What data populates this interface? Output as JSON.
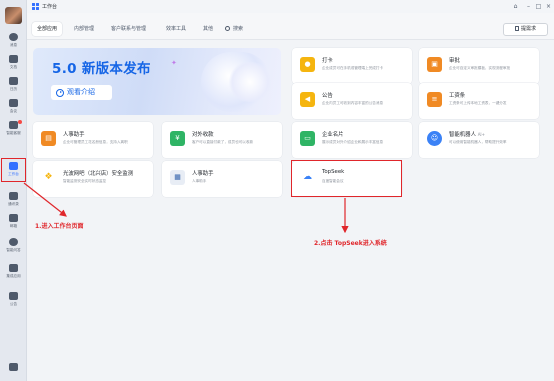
{
  "app": {
    "title": "工作台"
  },
  "window_buttons": [
    "⌂",
    "–",
    "□",
    "×"
  ],
  "rail": {
    "items": [
      {
        "label": "消息"
      },
      {
        "label": "文档"
      },
      {
        "label": "日历"
      },
      {
        "label": "会议"
      },
      {
        "label": "智能客服"
      },
      {
        "label": "工作台"
      },
      {
        "label": "通讯录"
      },
      {
        "label": "邮箱"
      },
      {
        "label": "智能问答"
      },
      {
        "label": "集成应用"
      },
      {
        "label": "公告"
      }
    ]
  },
  "toolbar": {
    "tabs": [
      {
        "label": "全部应用",
        "active": true
      },
      {
        "label": "内部管理",
        "active": false
      },
      {
        "label": "客户联系与管理",
        "active": false
      },
      {
        "label": "效率工具",
        "active": false
      },
      {
        "label": "其他",
        "active": false
      }
    ],
    "search_label": "搜索",
    "apply_label": "提需求"
  },
  "banner": {
    "headline": "5.0 新版本发布",
    "button_label": "观看介绍"
  },
  "cards": [
    {
      "title": "打卡",
      "desc": "企业成员可在手机或管理端上完成打卡",
      "icon": "location-icon",
      "color": "#f5b50f"
    },
    {
      "title": "审批",
      "desc": "企业可自定义审批模板，实现流程审批",
      "icon": "approval-icon",
      "color": "#f08a24"
    },
    {
      "title": "公告",
      "desc": "企业内员工可收到内容丰富的公告消息",
      "icon": "megaphone-icon",
      "color": "#f5b50f"
    },
    {
      "title": "工资条",
      "desc": "工资条可上传本地工资表，一键分发",
      "icon": "payslip-icon",
      "color": "#f08a24"
    },
    {
      "title": "人事助手",
      "desc": "企业可管理员工花名册信息，支持入离职",
      "icon": "hr-icon",
      "color": "#f08a24"
    },
    {
      "title": "对外收款",
      "desc": "客户可以直接付款了，成员也可以收款",
      "icon": "payment-icon",
      "color": "#2fb465"
    },
    {
      "title": "企业名片",
      "desc": "展示成员对外介绍企业和展示丰富信息",
      "icon": "card-icon",
      "color": "#2fb465"
    },
    {
      "title": "智能机器人",
      "badge": "AI+",
      "desc": "可以使用智能机器人，帮助提升效率",
      "icon": "robot-icon",
      "color": "#3b82f6"
    },
    {
      "title": "光波网吧（北兴店）安全监测",
      "desc": "智能监测安全实时状态监控",
      "icon": "logo-icon",
      "color": "#f5b50f"
    },
    {
      "title": "人事助手",
      "desc": "人事助手",
      "icon": "chart-icon",
      "color": "#2c5da8"
    },
    {
      "title": "TopSeek",
      "desc": "百度智能会议",
      "icon": "topseek-icon",
      "color": "#3b82f6"
    }
  ],
  "annotations": {
    "step1": "1.进入工作台页面",
    "step2": "2.点击 TopSeek进入系统",
    "color": "#e0262b"
  }
}
